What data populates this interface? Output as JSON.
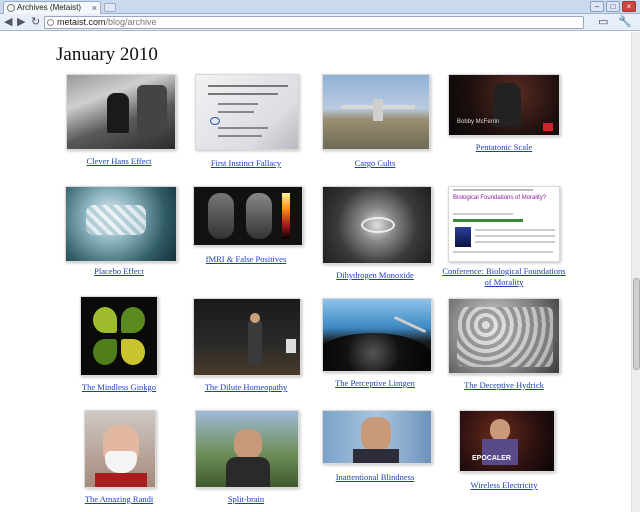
{
  "browser": {
    "tab_title": "Archives (Metaist)",
    "url_host": "metaist.com",
    "url_path": "/blog/archive"
  },
  "page": {
    "heading": "January 2010",
    "items": [
      {
        "title": "Clever Hans Effect"
      },
      {
        "title": "First Instinct Fallacy"
      },
      {
        "title": "Cargo Cults"
      },
      {
        "title": "Pentatonic Scale"
      },
      {
        "title": "Placebo Effect"
      },
      {
        "title": "fMRI & False Positives"
      },
      {
        "title": "Dihydrogen Monoxide"
      },
      {
        "title": "Conference: Biological Foundations of Morality"
      },
      {
        "title": "The Mindless Ginkgo"
      },
      {
        "title": "The Dilute Homeopathy"
      },
      {
        "title": "The Perceptive Lintgen"
      },
      {
        "title": "The Deceptive Hydrick"
      },
      {
        "title": "The Amazing Randi"
      },
      {
        "title": "Split-brain"
      },
      {
        "title": "Inattentional Blindness"
      },
      {
        "title": "Wireless Electricity"
      }
    ]
  },
  "thumb_text": {
    "pentatonic_caption": "Bobby McFerrin",
    "conference_heading": "Biological Foundations of Morality?",
    "wireless_overlay": "EPOCALER"
  },
  "colors": {
    "link": "#1a3fae",
    "chrome": "#c9d9ee"
  }
}
